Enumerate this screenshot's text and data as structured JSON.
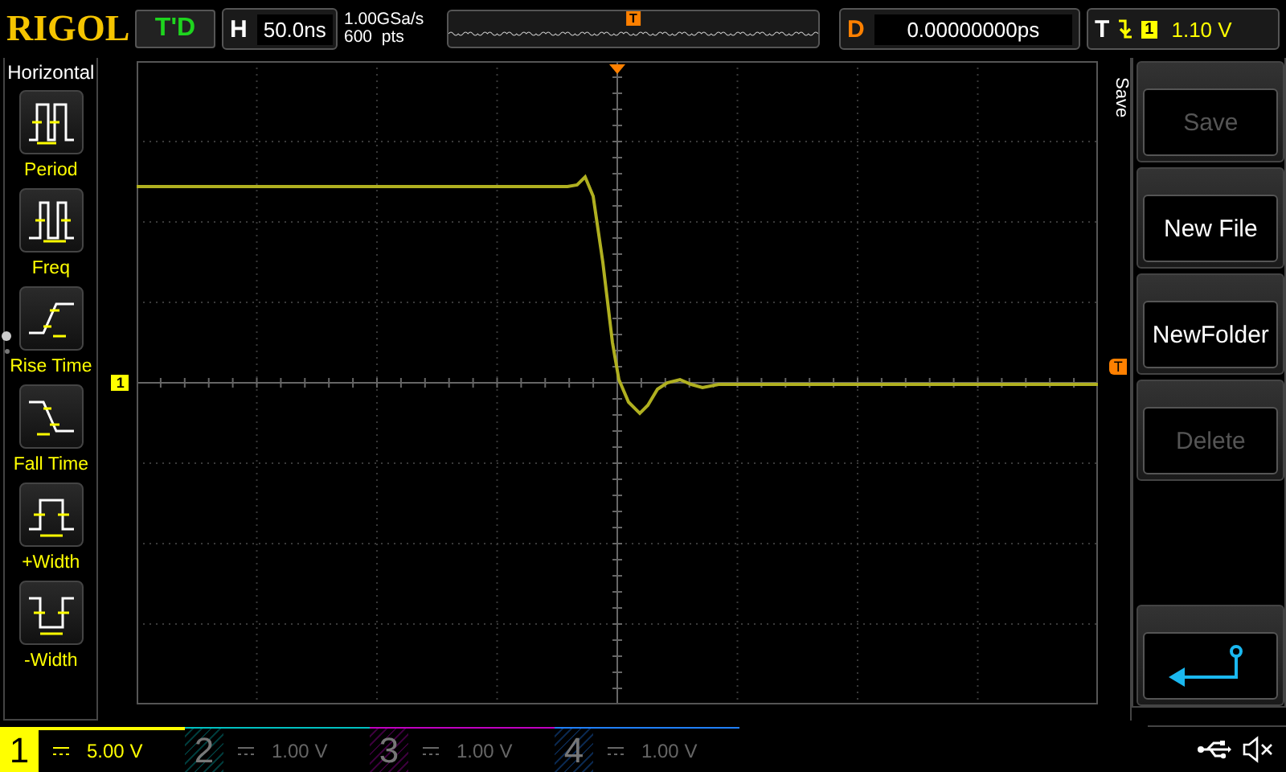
{
  "header": {
    "logo": "RIGOL",
    "run_status": "T'D",
    "horizontal": {
      "label": "H",
      "value": "50.0ns"
    },
    "sample_rate": "1.00GSa/s",
    "memory_depth": "600  pts",
    "trigger_marker": "T",
    "delay": {
      "label": "D",
      "value": "0.00000000ps"
    },
    "trigger": {
      "label": "T",
      "source": "1",
      "level": "1.10 V"
    }
  },
  "measure_panel": {
    "title": "Horizontal",
    "items": [
      {
        "kind": "period",
        "label": "Period"
      },
      {
        "kind": "freq",
        "label": "Freq"
      },
      {
        "kind": "rise",
        "label": "Rise Time"
      },
      {
        "kind": "fall",
        "label": "Fall Time"
      },
      {
        "kind": "pwidth",
        "label": "+Width"
      },
      {
        "kind": "nwidth",
        "label": "-Width"
      }
    ]
  },
  "scope": {
    "channel_marker": "1",
    "trigger_level_marker": "T"
  },
  "softkey_menu": {
    "title": "Save",
    "items": [
      {
        "kind": "text",
        "label": "Save",
        "disabled": true
      },
      {
        "kind": "text",
        "label": "New File",
        "disabled": false
      },
      {
        "kind": "text",
        "label": "NewFolder",
        "disabled": false
      },
      {
        "kind": "text",
        "label": "Delete",
        "disabled": true
      },
      {
        "kind": "spacer"
      },
      {
        "kind": "back"
      }
    ]
  },
  "channels": [
    {
      "number": "1",
      "scale": "5.00 V",
      "active": true,
      "color": "#ffff00"
    },
    {
      "number": "2",
      "scale": "1.00 V",
      "active": false,
      "color": "#00c0c0"
    },
    {
      "number": "3",
      "scale": "1.00 V",
      "active": false,
      "color": "#c000c0"
    },
    {
      "number": "4",
      "scale": "1.00 V",
      "active": false,
      "color": "#2080ff"
    }
  ]
}
